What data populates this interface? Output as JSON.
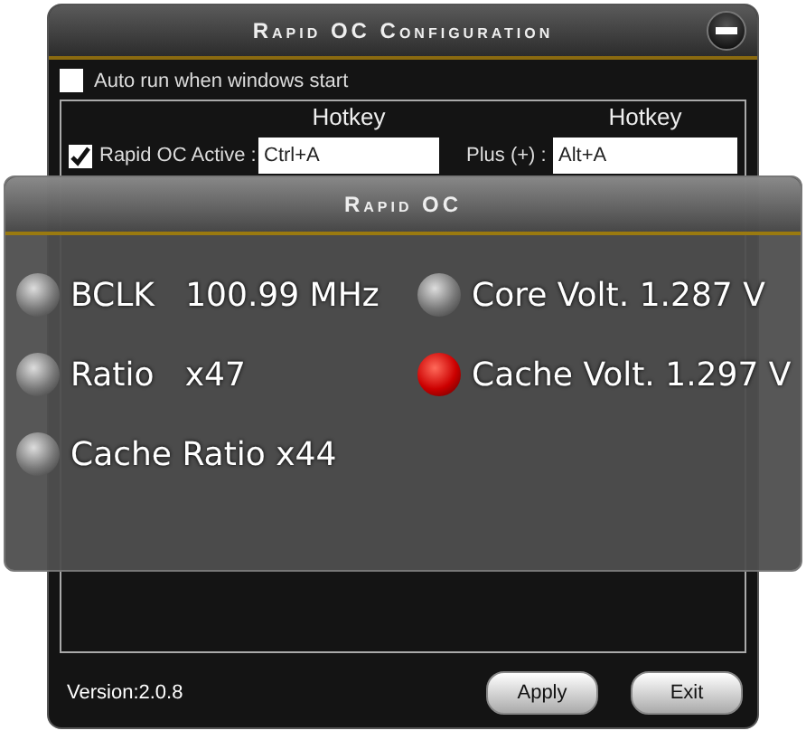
{
  "window": {
    "title": "Rapid OC Configuration"
  },
  "auto_run": {
    "label": "Auto run when windows start",
    "checked": false
  },
  "hotkeys": {
    "columns": [
      "Hotkey",
      "Hotkey"
    ],
    "rows": [
      {
        "kind": "checkbox",
        "label": "Rapid OC Active :",
        "checked": true,
        "hotkey": "Ctrl+A",
        "label_2": "Plus (+) :",
        "hotkey_2": "Alt+A"
      }
    ]
  },
  "footer": {
    "version": "Version:2.0.8",
    "buttons": [
      "Apply",
      "Exit"
    ]
  },
  "osd": {
    "title": "Rapid OC",
    "items": [
      {
        "text": "BCLK   100.99 MHz",
        "active": false
      },
      {
        "text": "Core Volt. 1.287 V",
        "active": false
      },
      {
        "text": "Ratio   x47",
        "active": false
      },
      {
        "text": "Cache Volt. 1.297 V",
        "active": true
      },
      {
        "text": "Cache Ratio x44",
        "active": false
      }
    ]
  }
}
